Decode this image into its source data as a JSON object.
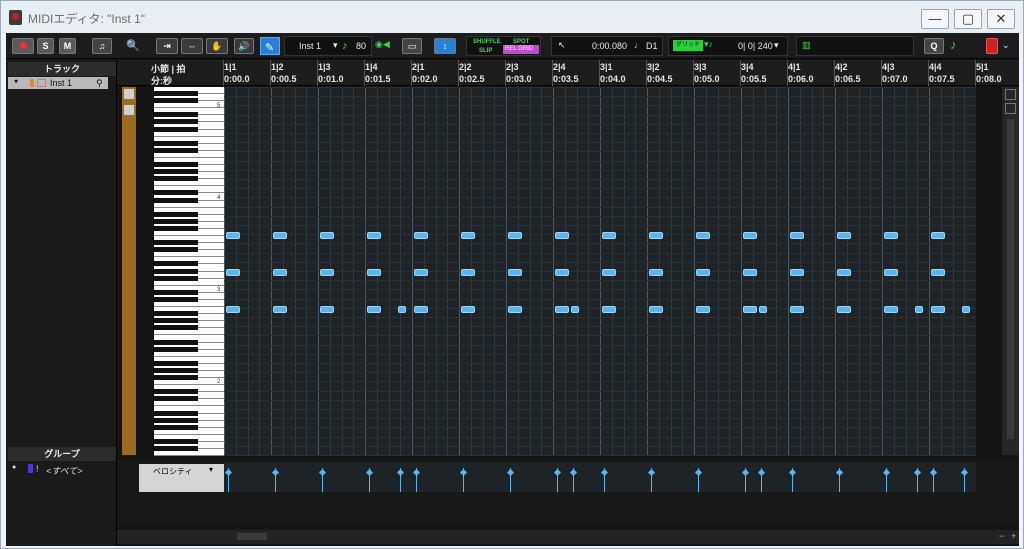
{
  "window": {
    "title": "MIDIエディタ: \"Inst 1\"",
    "minimize": "—",
    "maximize": "▢",
    "close": "✕"
  },
  "toolbar": {
    "solo": "S",
    "mute": "M",
    "instrument": "Inst 1",
    "tempo": "80",
    "edit_modes": {
      "shuffle": "SHUFFLE",
      "spot": "SPOT",
      "slip": "SLIP",
      "rel_grid": "REL GRID"
    },
    "position": "0:00.080",
    "duration_note": "D1",
    "grid_mode": "グリッド",
    "grid_value": "0| 0| 240",
    "quantize": "Q"
  },
  "sidebar": {
    "tracks_header": "トラック",
    "track_name": "Inst 1",
    "groups_header": "グループ",
    "group_name": "<すべて>"
  },
  "ruler": {
    "bars_label": "小節 | 拍",
    "time_label": "分:秒",
    "bars": [
      "1|1",
      "1|2",
      "1|3",
      "1|4",
      "2|1",
      "2|2",
      "2|3",
      "2|4",
      "3|1",
      "3|2",
      "3|3",
      "3|4",
      "4|1",
      "4|2",
      "4|3",
      "4|4",
      "5|1"
    ],
    "times": [
      "0:00.0",
      "0:00.5",
      "0:01.0",
      "0:01.5",
      "0:02.0",
      "0:02.5",
      "0:03.0",
      "0:03.5",
      "0:04.0",
      "0:04.5",
      "0:05.0",
      "0:05.5",
      "0:06.0",
      "0:06.5",
      "0:07.0",
      "0:07.5",
      "0:08.0"
    ]
  },
  "keyboard": {
    "octave_labels": [
      "5",
      "4",
      "3",
      "2"
    ]
  },
  "notes": {
    "row1_beats": [
      0,
      0.5,
      1,
      1.5,
      2,
      2.5,
      3,
      3.5,
      4,
      4.5,
      5,
      5.5,
      6,
      6.5,
      7,
      7.5
    ],
    "row2_beats": [
      0,
      0.5,
      1,
      1.5,
      2,
      2.5,
      3,
      3.5,
      4,
      4.5,
      5,
      5.5,
      6,
      6.5,
      7,
      7.5
    ],
    "row3_beats": [
      0,
      0.5,
      1,
      1.5,
      1.83,
      2,
      2.5,
      3,
      3.5,
      3.67,
      4,
      4.5,
      5,
      5.5,
      5.67,
      6,
      6.5,
      7,
      7.33,
      7.5,
      7.83
    ]
  },
  "velocity_lane": {
    "label": "ベロシティ"
  }
}
